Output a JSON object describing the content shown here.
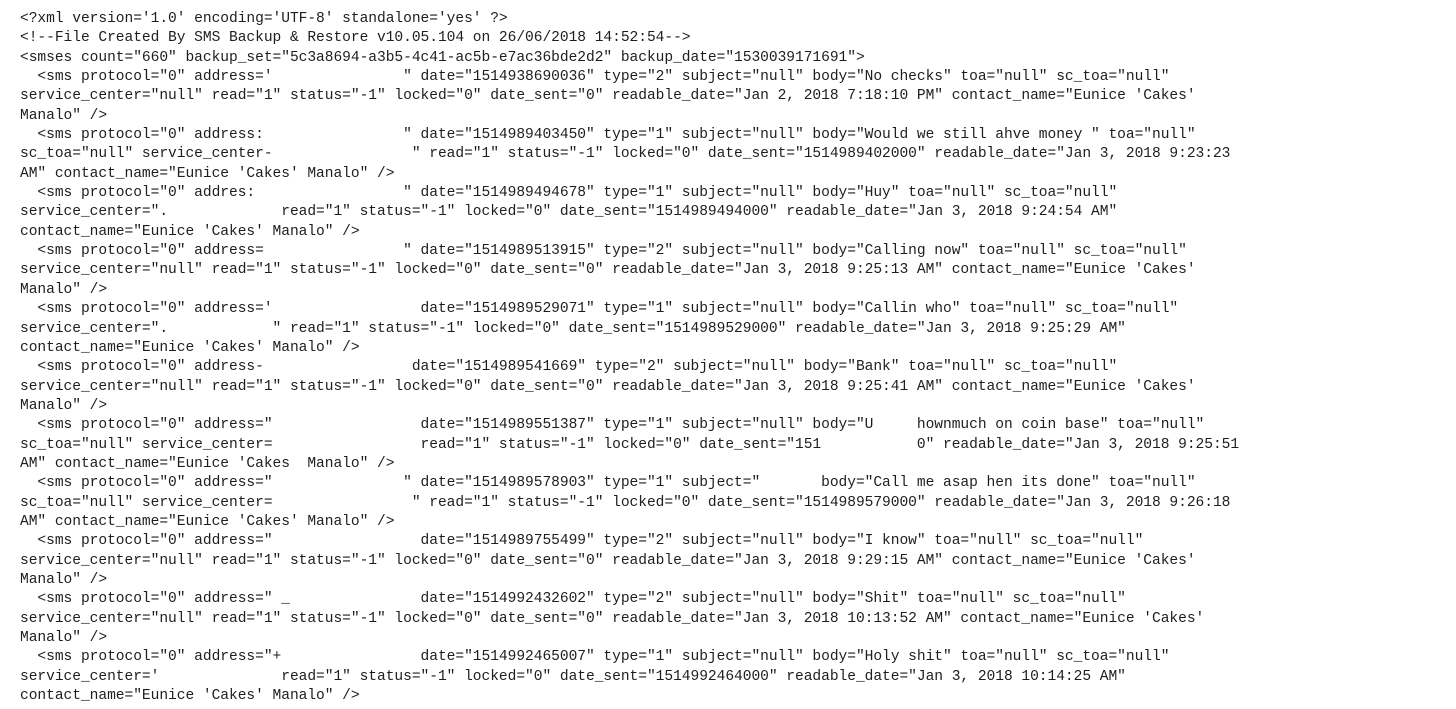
{
  "document": {
    "lines": [
      "<?xml version='1.0' encoding='UTF-8' standalone='yes' ?>",
      "<!--File Created By SMS Backup & Restore v10.05.104 on 26/06/2018 14:52:54-->",
      "<smses count=\"660\" backup_set=\"5c3a8694-a3b5-4c41-ac5b-e7ac36bde2d2\" backup_date=\"1530039171691\">",
      "  <sms protocol=\"0\" address='               \" date=\"1514938690036\" type=\"2\" subject=\"null\" body=\"No checks\" toa=\"null\" sc_toa=\"null\"",
      "service_center=\"null\" read=\"1\" status=\"-1\" locked=\"0\" date_sent=\"0\" readable_date=\"Jan 2, 2018 7:18:10 PM\" contact_name=\"Eunice 'Cakes'",
      "Manalo\" />",
      "  <sms protocol=\"0\" address:                \" date=\"1514989403450\" type=\"1\" subject=\"null\" body=\"Would we still ahve money \" toa=\"null\"",
      "sc_toa=\"null\" service_center-                \" read=\"1\" status=\"-1\" locked=\"0\" date_sent=\"1514989402000\" readable_date=\"Jan 3, 2018 9:23:23",
      "AM\" contact_name=\"Eunice 'Cakes' Manalo\" />",
      "  <sms protocol=\"0\" addres:                 \" date=\"1514989494678\" type=\"1\" subject=\"null\" body=\"Huy\" toa=\"null\" sc_toa=\"null\"",
      "service_center=\".             read=\"1\" status=\"-1\" locked=\"0\" date_sent=\"1514989494000\" readable_date=\"Jan 3, 2018 9:24:54 AM\"",
      "contact_name=\"Eunice 'Cakes' Manalo\" />",
      "  <sms protocol=\"0\" address=                \" date=\"1514989513915\" type=\"2\" subject=\"null\" body=\"Calling now\" toa=\"null\" sc_toa=\"null\"",
      "service_center=\"null\" read=\"1\" status=\"-1\" locked=\"0\" date_sent=\"0\" readable_date=\"Jan 3, 2018 9:25:13 AM\" contact_name=\"Eunice 'Cakes'",
      "Manalo\" />",
      "  <sms protocol=\"0\" address='                 date=\"1514989529071\" type=\"1\" subject=\"null\" body=\"Callin who\" toa=\"null\" sc_toa=\"null\"",
      "service_center=\".            \" read=\"1\" status=\"-1\" locked=\"0\" date_sent=\"1514989529000\" readable_date=\"Jan 3, 2018 9:25:29 AM\"",
      "contact_name=\"Eunice 'Cakes' Manalo\" />",
      "  <sms protocol=\"0\" address-                 date=\"1514989541669\" type=\"2\" subject=\"null\" body=\"Bank\" toa=\"null\" sc_toa=\"null\"",
      "service_center=\"null\" read=\"1\" status=\"-1\" locked=\"0\" date_sent=\"0\" readable_date=\"Jan 3, 2018 9:25:41 AM\" contact_name=\"Eunice 'Cakes'",
      "Manalo\" />",
      "  <sms protocol=\"0\" address=\"                 date=\"1514989551387\" type=\"1\" subject=\"null\" body=\"U     hownmuch on coin base\" toa=\"null\"",
      "sc_toa=\"null\" service_center=                 read=\"1\" status=\"-1\" locked=\"0\" date_sent=\"151           0\" readable_date=\"Jan 3, 2018 9:25:51",
      "AM\" contact_name=\"Eunice 'Cakes  Manalo\" />",
      "  <sms protocol=\"0\" address=\"               \" date=\"1514989578903\" type=\"1\" subject=\"       body=\"Call me asap hen its done\" toa=\"null\"",
      "sc_toa=\"null\" service_center=                \" read=\"1\" status=\"-1\" locked=\"0\" date_sent=\"1514989579000\" readable_date=\"Jan 3, 2018 9:26:18",
      "AM\" contact_name=\"Eunice 'Cakes' Manalo\" />",
      "  <sms protocol=\"0\" address=\"                 date=\"1514989755499\" type=\"2\" subject=\"null\" body=\"I know\" toa=\"null\" sc_toa=\"null\"",
      "service_center=\"null\" read=\"1\" status=\"-1\" locked=\"0\" date_sent=\"0\" readable_date=\"Jan 3, 2018 9:29:15 AM\" contact_name=\"Eunice 'Cakes'",
      "Manalo\" />",
      "  <sms protocol=\"0\" address=\" _               date=\"1514992432602\" type=\"2\" subject=\"null\" body=\"Shit\" toa=\"null\" sc_toa=\"null\"",
      "service_center=\"null\" read=\"1\" status=\"-1\" locked=\"0\" date_sent=\"0\" readable_date=\"Jan 3, 2018 10:13:52 AM\" contact_name=\"Eunice 'Cakes'",
      "Manalo\" />",
      "  <sms protocol=\"0\" address=\"+                date=\"1514992465007\" type=\"1\" subject=\"null\" body=\"Holy shit\" toa=\"null\" sc_toa=\"null\"",
      "service_center='              read=\"1\" status=\"-1\" locked=\"0\" date_sent=\"1514992464000\" readable_date=\"Jan 3, 2018 10:14:25 AM\"",
      "contact_name=\"Eunice 'Cakes' Manalo\" />"
    ]
  }
}
